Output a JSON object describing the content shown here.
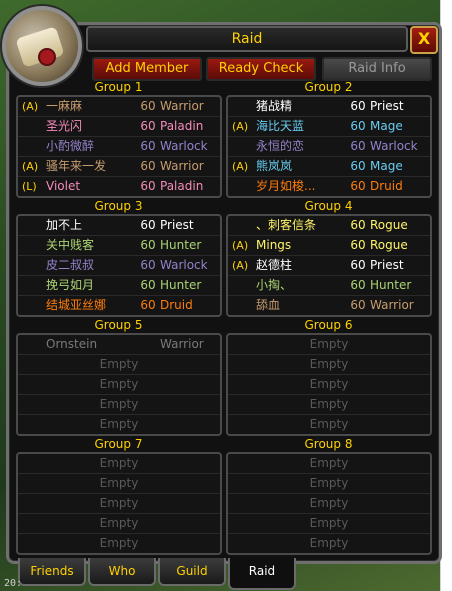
{
  "window": {
    "title": "Raid",
    "close_label": "X"
  },
  "toolbar": {
    "add_member": "Add Member",
    "ready_check": "Ready Check",
    "raid_info": "Raid Info"
  },
  "colors": {
    "warrior": "#c79c6e",
    "paladin": "#f58cba",
    "warlock": "#9482c9",
    "priest": "#ffffff",
    "mage": "#69ccf0",
    "druid": "#ff7d0a",
    "rogue": "#fff569",
    "hunter": "#abd473",
    "offline": "#7a7a7a",
    "gold": "#ffd100"
  },
  "groups": [
    {
      "title": "Group 1",
      "slots": [
        {
          "tag": "(A)",
          "name": "一麻麻",
          "level": "60",
          "class": "Warrior",
          "color": "#c79c6e"
        },
        {
          "tag": "",
          "name": "圣光闪",
          "level": "60",
          "class": "Paladin",
          "color": "#f58cba"
        },
        {
          "tag": "",
          "name": "小酌微醉",
          "level": "60",
          "class": "Warlock",
          "color": "#9482c9"
        },
        {
          "tag": "(A)",
          "name": "骚年来一发",
          "level": "60",
          "class": "Warrior",
          "color": "#c79c6e"
        },
        {
          "tag": "(L)",
          "name": "Violet",
          "level": "60",
          "class": "Paladin",
          "color": "#f58cba"
        }
      ]
    },
    {
      "title": "Group 2",
      "slots": [
        {
          "tag": "",
          "name": "猪战精",
          "level": "60",
          "class": "Priest",
          "color": "#ffffff"
        },
        {
          "tag": "(A)",
          "name": "海比天蓝",
          "level": "60",
          "class": "Mage",
          "color": "#69ccf0"
        },
        {
          "tag": "",
          "name": "永恒的恋",
          "level": "60",
          "class": "Warlock",
          "color": "#9482c9"
        },
        {
          "tag": "(A)",
          "name": "熊岚岚",
          "level": "60",
          "class": "Mage",
          "color": "#69ccf0"
        },
        {
          "tag": "",
          "name": "岁月如梭...",
          "level": "60",
          "class": "Druid",
          "color": "#ff7d0a"
        }
      ]
    },
    {
      "title": "Group 3",
      "slots": [
        {
          "tag": "",
          "name": "加不上",
          "level": "60",
          "class": "Priest",
          "color": "#ffffff"
        },
        {
          "tag": "",
          "name": "关中贱客",
          "level": "60",
          "class": "Hunter",
          "color": "#abd473"
        },
        {
          "tag": "",
          "name": "皮二叔叔",
          "level": "60",
          "class": "Warlock",
          "color": "#9482c9"
        },
        {
          "tag": "",
          "name": "挽弓如月",
          "level": "60",
          "class": "Hunter",
          "color": "#abd473"
        },
        {
          "tag": "",
          "name": "结城亚丝娜",
          "level": "60",
          "class": "Druid",
          "color": "#ff7d0a"
        }
      ]
    },
    {
      "title": "Group 4",
      "slots": [
        {
          "tag": "",
          "name": "、刺客信条",
          "level": "60",
          "class": "Rogue",
          "color": "#fff569"
        },
        {
          "tag": "(A)",
          "name": "Mings",
          "level": "60",
          "class": "Rogue",
          "color": "#fff569"
        },
        {
          "tag": "(A)",
          "name": "赵德柱",
          "level": "60",
          "class": "Priest",
          "color": "#ffffff"
        },
        {
          "tag": "",
          "name": "小掏、",
          "level": "60",
          "class": "Hunter",
          "color": "#abd473"
        },
        {
          "tag": "",
          "name": "舔血",
          "level": "60",
          "class": "Warrior",
          "color": "#c79c6e"
        }
      ]
    },
    {
      "title": "Group 5",
      "slots": [
        {
          "tag": "",
          "name": "Ornstein",
          "level": "",
          "class": "Warrior",
          "color": "#7a7a7a"
        },
        {
          "empty": "Empty"
        },
        {
          "empty": "Empty"
        },
        {
          "empty": "Empty"
        },
        {
          "empty": "Empty"
        }
      ]
    },
    {
      "title": "Group 6",
      "slots": [
        {
          "empty": "Empty"
        },
        {
          "empty": "Empty"
        },
        {
          "empty": "Empty"
        },
        {
          "empty": "Empty"
        },
        {
          "empty": "Empty"
        }
      ]
    },
    {
      "title": "Group 7",
      "slots": [
        {
          "empty": "Empty"
        },
        {
          "empty": "Empty"
        },
        {
          "empty": "Empty"
        },
        {
          "empty": "Empty"
        },
        {
          "empty": "Empty"
        }
      ]
    },
    {
      "title": "Group 8",
      "slots": [
        {
          "empty": "Empty"
        },
        {
          "empty": "Empty"
        },
        {
          "empty": "Empty"
        },
        {
          "empty": "Empty"
        },
        {
          "empty": "Empty"
        }
      ]
    }
  ],
  "tabs": [
    {
      "label": "Friends",
      "active": false
    },
    {
      "label": "Who",
      "active": false
    },
    {
      "label": "Guild",
      "active": false
    },
    {
      "label": "Raid",
      "active": true
    }
  ],
  "footer_text": "20:"
}
